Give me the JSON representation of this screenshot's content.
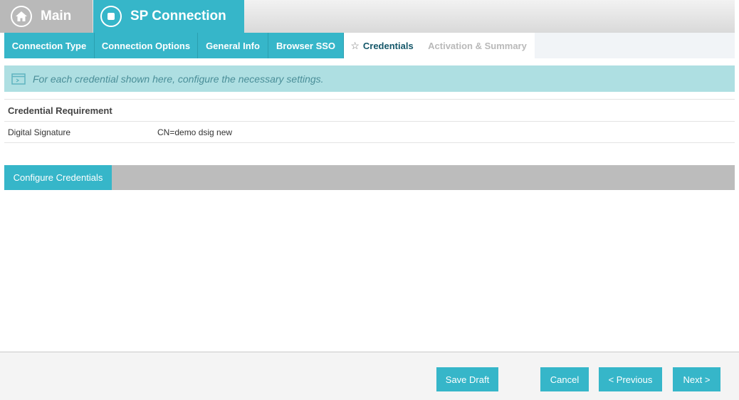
{
  "top_tabs": {
    "main": "Main",
    "sp_connection": "SP Connection"
  },
  "sub_tabs": [
    {
      "label": "Connection Type"
    },
    {
      "label": "Connection Options"
    },
    {
      "label": "General Info"
    },
    {
      "label": "Browser SSO"
    },
    {
      "label": "Credentials"
    },
    {
      "label": "Activation & Summary"
    }
  ],
  "info": {
    "message": "For each credential shown here, configure the necessary settings."
  },
  "table": {
    "header": "Credential Requirement",
    "rows": [
      {
        "name": "Digital Signature",
        "value": "CN=demo dsig new"
      }
    ]
  },
  "configure_button": "Configure Credentials",
  "footer": {
    "save_draft": "Save Draft",
    "cancel": "Cancel",
    "previous": "< Previous",
    "next": "Next >"
  },
  "colors": {
    "accent": "#36b6c9",
    "info_bg": "#aedfe2",
    "inactive": "#b9b9b9"
  }
}
